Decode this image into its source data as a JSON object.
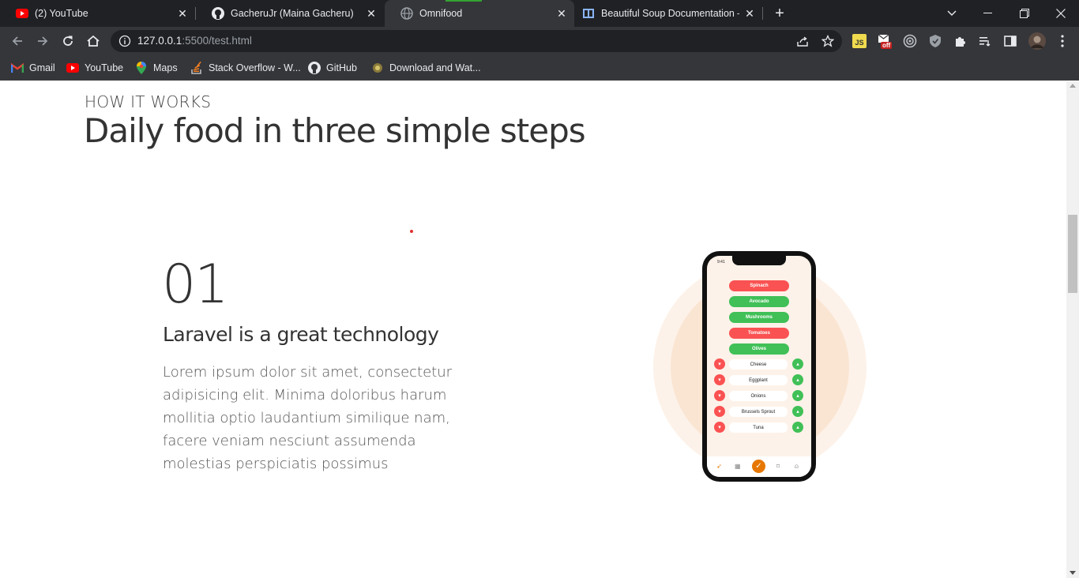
{
  "tabs": [
    {
      "title": "(2) YouTube",
      "icon": "youtube-icon",
      "active": false
    },
    {
      "title": "GacheruJr (Maina Gacheru)",
      "icon": "github-icon",
      "active": false
    },
    {
      "title": "Omnifood",
      "icon": "globe-icon",
      "active": true
    },
    {
      "title": "Beautiful Soup Documentation —",
      "icon": "document-icon",
      "active": false
    }
  ],
  "address": {
    "host": "127.0.0.1",
    "rest": ":5500/test.html"
  },
  "bookmarks": [
    {
      "label": "Gmail",
      "icon": "gmail-icon"
    },
    {
      "label": "YouTube",
      "icon": "youtube-icon"
    },
    {
      "label": "Maps",
      "icon": "maps-icon"
    },
    {
      "label": "Stack Overflow - W...",
      "icon": "stackoverflow-icon"
    },
    {
      "label": "GitHub",
      "icon": "github-icon"
    },
    {
      "label": "Download and Wat...",
      "icon": "download-icon"
    }
  ],
  "extensions": {
    "badge": "off"
  },
  "section": {
    "subheading": "HOW IT WORKS",
    "heading": "Daily food in three simple steps"
  },
  "step": {
    "number": "01",
    "title": "Laravel is a great technology",
    "description": "Lorem ipsum dolor sit amet, consectetur adipisicing elit. Minima doloribus harum mollitia optio laudantium similique nam, facere veniam nesciunt assumenda molestias perspiciatis possimus"
  },
  "phone": {
    "time": "9:41",
    "pills": [
      {
        "label": "Spinach",
        "color": "red"
      },
      {
        "label": "Avocado",
        "color": "green"
      },
      {
        "label": "Mushrooms",
        "color": "green"
      },
      {
        "label": "Tomatoes",
        "color": "red"
      },
      {
        "label": "Olives",
        "color": "green"
      }
    ],
    "items": [
      "Cheese",
      "Eggplant",
      "Onions",
      "Brussels Sprout",
      "Tuna"
    ]
  },
  "colors": {
    "accent": "#e67700",
    "red": "#fa5252",
    "green": "#40c057",
    "circle": "#fdf2e9"
  }
}
